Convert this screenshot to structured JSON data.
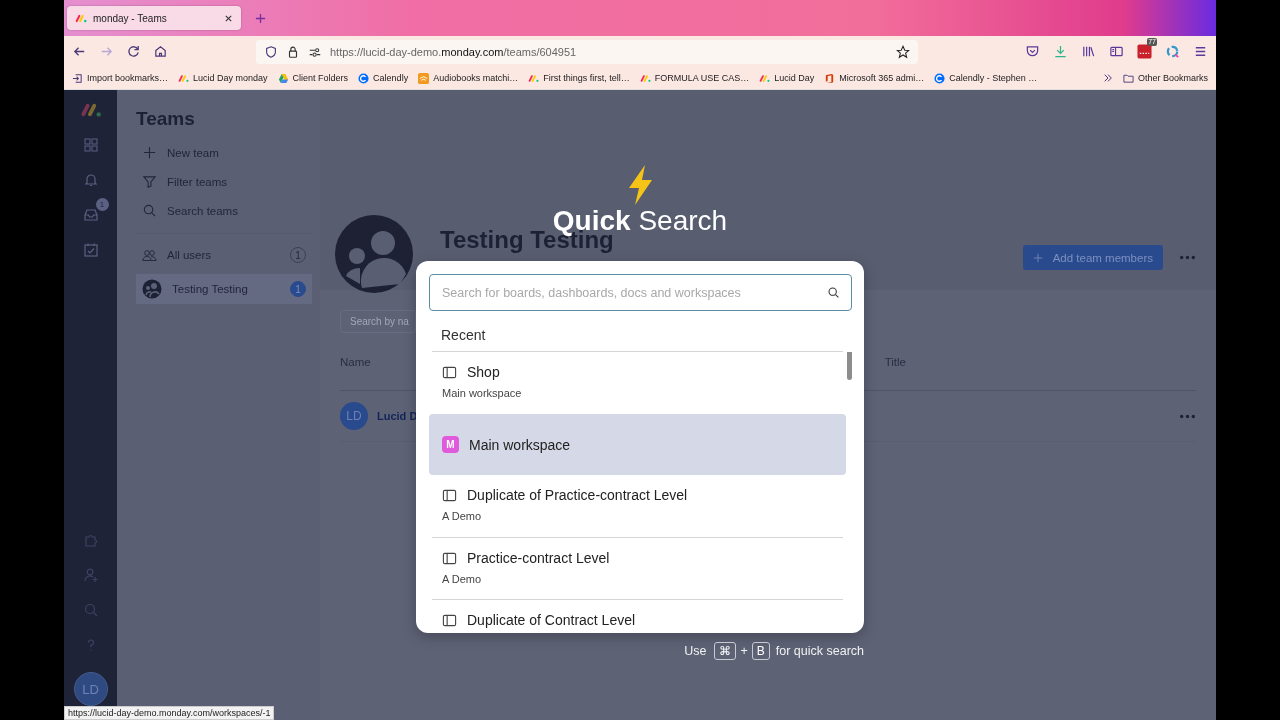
{
  "browser": {
    "tab": {
      "title": "monday - Teams"
    },
    "url": {
      "prefix": "https://lucid-day-demo.",
      "domain": "monday.com",
      "path": "/teams/604951"
    },
    "extension_badge": "77",
    "bookmarks": [
      {
        "kind": "import",
        "label": "Import bookmarks…"
      },
      {
        "kind": "monday",
        "label": "Lucid Day monday"
      },
      {
        "kind": "drive",
        "label": "Client Folders"
      },
      {
        "kind": "calendly",
        "label": "Calendly"
      },
      {
        "kind": "audible",
        "label": "Audiobooks matchi…"
      },
      {
        "kind": "monday",
        "label": "First things first, tell…"
      },
      {
        "kind": "monday",
        "label": "FORMULA USE CAS…"
      },
      {
        "kind": "monday",
        "label": "Lucid Day"
      },
      {
        "kind": "office",
        "label": "Microsoft 365 admi…"
      },
      {
        "kind": "calendly",
        "label": "Calendly - Stephen …"
      }
    ],
    "other_bookmarks": "Other Bookmarks",
    "status_url": "https://lucid-day-demo.monday.com/workspaces/-1"
  },
  "rail": {
    "inbox_badge": "1",
    "avatar": "LD"
  },
  "sidebar": {
    "title": "Teams",
    "actions": [
      {
        "kind": "add",
        "label": "New team"
      },
      {
        "kind": "filter",
        "label": "Filter teams"
      },
      {
        "kind": "search",
        "label": "Search teams"
      }
    ],
    "teams": [
      {
        "kind": "users",
        "label": "All users",
        "count": "1",
        "selected": false
      },
      {
        "kind": "team",
        "label": "Testing Testing",
        "count": "1",
        "selected": true
      }
    ]
  },
  "team": {
    "title": "Testing Testing",
    "add_button": "Add team members",
    "search": {
      "placeholder": "Search by na"
    },
    "columns": [
      "Name",
      "Title"
    ],
    "members": [
      {
        "initials": "LD",
        "name": "Lucid D"
      }
    ]
  },
  "quick_search": {
    "title_bold": "Quick",
    "title_rest": "Search",
    "placeholder": "Search for boards, dashboards, docs and workspaces",
    "section": "Recent",
    "items": [
      {
        "kind": "board",
        "title": "Shop",
        "subtitle": "Main workspace",
        "selected": false
      },
      {
        "kind": "workspace",
        "badge": "M",
        "title": "Main workspace",
        "selected": true
      },
      {
        "kind": "board",
        "title": "Duplicate of Practice-contract Level",
        "subtitle": "A Demo",
        "selected": false
      },
      {
        "kind": "board",
        "title": "Practice-contract Level",
        "subtitle": "A Demo",
        "selected": false
      },
      {
        "kind": "board",
        "title": "Duplicate of Contract Level",
        "selected": false
      }
    ],
    "hint": {
      "before": "Use",
      "keys": [
        "⌘",
        "B"
      ],
      "plus": "+",
      "after": "for quick search"
    }
  }
}
